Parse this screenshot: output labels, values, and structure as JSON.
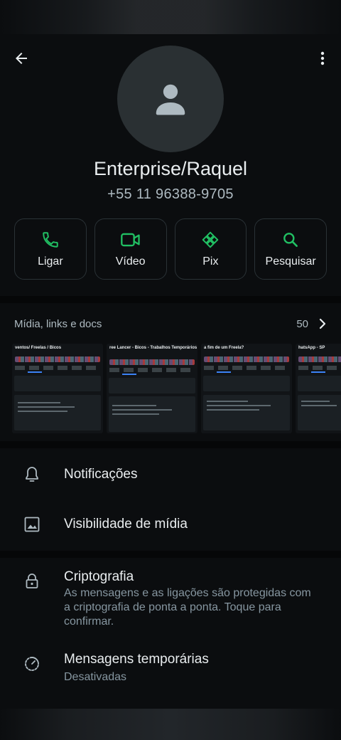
{
  "header": {
    "back_icon": "arrow-back-icon",
    "menu_icon": "more-vert-icon"
  },
  "contact": {
    "name": "Enterprise/Raquel",
    "phone": "+55 11 96388-9705",
    "avatar_icon": "person-icon"
  },
  "actions": [
    {
      "label": "Ligar",
      "icon": "phone-icon"
    },
    {
      "label": "Vídeo",
      "icon": "video-icon"
    },
    {
      "label": "Pix",
      "icon": "pix-icon"
    },
    {
      "label": "Pesquisar",
      "icon": "search-icon"
    }
  ],
  "media": {
    "title": "Mídia, links e docs",
    "count": "50",
    "thumbnails": [
      {
        "title": "ventos/ Freelas / Bicos"
      },
      {
        "title": "ree Lancer - Bicos - Trabalhos Temporários"
      },
      {
        "title": "a fim de um Freela?"
      },
      {
        "title": "hatsApp - SP"
      }
    ]
  },
  "settings": {
    "notifications": "Notificações",
    "media_visibility": "Visibilidade de mídia",
    "encryption_title": "Criptografia",
    "encryption_sub": "As mensagens e as ligações são protegidas com a criptografia de ponta a ponta. Toque para confirmar.",
    "disappearing_title": "Mensagens temporárias",
    "disappearing_sub": "Desativadas"
  },
  "colors": {
    "accent": "#21c063",
    "background": "#0b0d0f",
    "text_primary": "#e9edef",
    "text_secondary": "#8696a0"
  }
}
